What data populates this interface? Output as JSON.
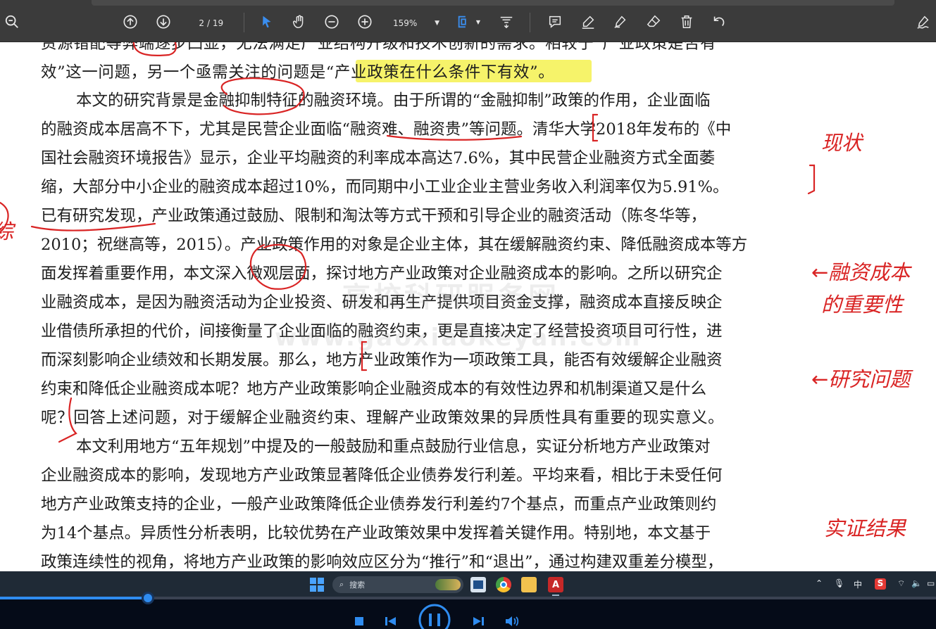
{
  "toolbar": {
    "page_current": "2",
    "page_total": "/ 19",
    "zoom": "159%"
  },
  "document": {
    "line_0": [
      "资源错配等弊端逐步凸显，无法满足产业结构升级和技术创新的需求。相较于“产业政策是否有"
    ],
    "line_1": [
      "效”这一问题，另一个亟需关注的问题是“产业政策在什么条件下有效”。"
    ],
    "lines": [
      "本文的研究背景是金融抑制特征的融资环境。由于所谓的“金融抑制”政策的作用，企业面临",
      "的融资成本居高不下，尤其是民营企业面临“融资难、融资贵”等问题。清华大学2018年发布的《中",
      "国社会融资环境报告》显示，企业平均融资的利率成本高达7.6%，其中民营企业融资方式全面萎",
      "缩，大部分中小企业的融资成本超过10%，而同期中小工业企业主营业务收入利润率仅为5.91%。",
      "已有研究发现，产业政策通过鼓励、限制和淘汰等方式干预和引导企业的融资活动（陈冬华等，",
      "2010；祝继高等，2015）。产业政策作用的对象是企业主体，其在缓解融资约束、降低融资成本等方",
      "面发挥着重要作用，本文深入微观层面，探讨地方产业政策对企业融资成本的影响。之所以研究企",
      "业融资成本，是因为融资活动为企业投资、研发和再生产提供项目资金支撑，融资成本直接反映企",
      "业借债所承担的代价，间接衡量了企业面临的融资约束，更是直接决定了经营投资项目可行性，进",
      "而深刻影响企业绩效和长期发展。那么，地方产业政策作为一项政策工具，能否有效缓解企业融资",
      "约束和降低企业融资成本呢？地方产业政策影响企业融资成本的有效性边界和机制渠道又是什么",
      "呢？回答上述问题，对于缓解企业融资约束、理解产业政策效果的异质性具有重要的现实意义。",
      "本文利用地方“五年规划”中提及的一般鼓励和重点鼓励行业信息，实证分析地方产业政策对",
      "企业融资成本的影响，发现地方产业政策显著降低企业债券发行利差。平均来看，相比于未受任何",
      "地方产业政策支持的企业，一般产业政策降低企业债券发行利差约7个基点，而重点产业政策则约",
      "为14个基点。异质性分析表明，比较优势在产业政策效果中发挥着关键作用。特别地，本文基于",
      "政策连续性的视角，将地方产业政策的影响效应区分为“推行”和“退出”，通过构建双重差分模型，"
    ],
    "watermark_cn": "高校科研服务网",
    "watermark_en": "www.gaoxiaokeyan.com"
  },
  "annotations": {
    "note_status": "现状",
    "note_importance_1": "←融资成本",
    "note_importance_2": "的重要性",
    "note_question": "←研究问题",
    "note_result": "实证结果",
    "note_left": "综"
  },
  "taskbar": {
    "search_placeholder": "搜索",
    "ime_label": "中"
  },
  "player": {
    "progress": 0.158
  },
  "colors": {
    "toolbar_bg": "#3b3b3b",
    "highlight": "#f6f36a",
    "ink_red": "#d92424",
    "player_accent": "#2f8cf0",
    "taskbar_bg": "#1f2a36"
  }
}
